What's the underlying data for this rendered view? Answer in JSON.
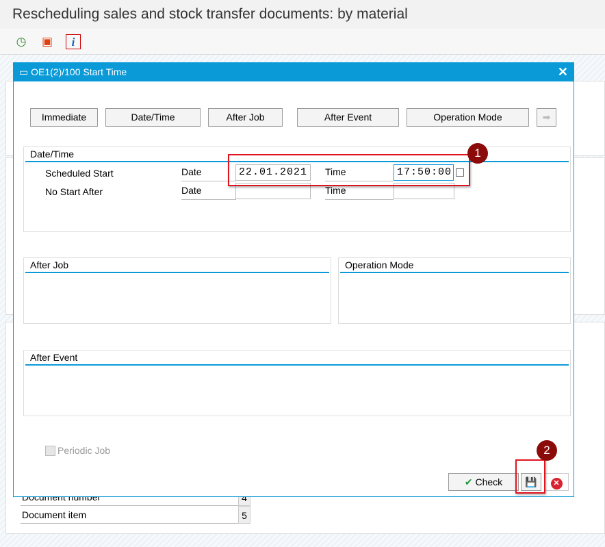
{
  "window": {
    "title": "Rescheduling sales and stock transfer documents: by material"
  },
  "toolbar": {
    "icons": [
      "execute-clock-icon",
      "variants-icon",
      "info-icon"
    ]
  },
  "background": {
    "rows": [
      {
        "label": "Document number",
        "value": "4"
      },
      {
        "label": "Document item",
        "value": "5"
      }
    ]
  },
  "dialog": {
    "title": "OE1(2)/100 Start Time",
    "buttons": [
      "Immediate",
      "Date/Time",
      "After Job",
      "After Event",
      "Operation Mode"
    ],
    "datetime": {
      "title": "Date/Time",
      "scheduled_start": "Scheduled Start",
      "no_start_after": "No Start After",
      "date_label": "Date",
      "time_label": "Time",
      "start_date": "22.01.2021",
      "start_time": "17:50:00",
      "nsa_date": "",
      "nsa_time": ""
    },
    "after_job": "After Job",
    "operation_mode": "Operation Mode",
    "after_event": "After Event",
    "periodic_job": "Periodic Job",
    "periodic_checked": false,
    "check": "Check"
  },
  "annotations": [
    "1",
    "2"
  ],
  "colors": {
    "accent": "#0a9ad8",
    "highlight": "#e0141e",
    "badge": "#8b0a0a"
  }
}
